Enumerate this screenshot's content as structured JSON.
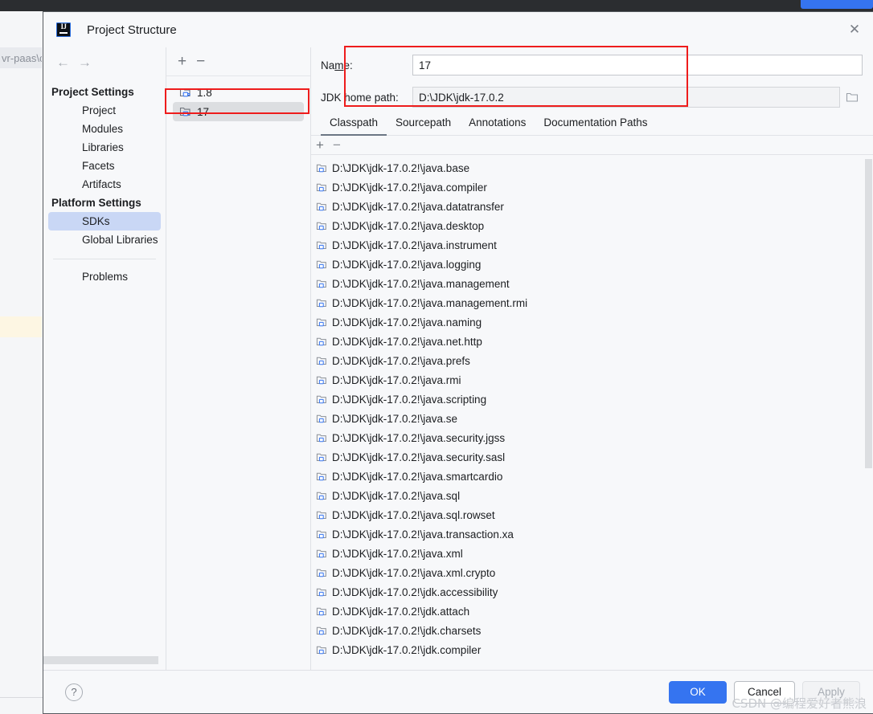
{
  "background": {
    "breadcrumb_text": "vr-paas\\c",
    "accent_blue": "#3574f0",
    "topbar_color": "#2b2d30"
  },
  "dialog": {
    "title": "Project Structure",
    "logo_icon": "intellij-idea-logo-icon",
    "close_icon": "close-icon"
  },
  "nav": {
    "back_icon": "arrow-left-icon",
    "forward_icon": "arrow-right-icon",
    "groups": [
      {
        "header": "Project Settings",
        "items": [
          {
            "label": "Project",
            "selected": false
          },
          {
            "label": "Modules",
            "selected": false
          },
          {
            "label": "Libraries",
            "selected": false
          },
          {
            "label": "Facets",
            "selected": false
          },
          {
            "label": "Artifacts",
            "selected": false
          }
        ]
      },
      {
        "header": "Platform Settings",
        "items": [
          {
            "label": "SDKs",
            "selected": true
          },
          {
            "label": "Global Libraries",
            "selected": false
          }
        ]
      }
    ],
    "extra_items": [
      {
        "label": "Problems",
        "selected": false
      }
    ]
  },
  "sdk_pane": {
    "add_icon": "plus-icon",
    "remove_icon": "minus-icon",
    "items": [
      {
        "label": "1.8",
        "icon": "jdk-icon",
        "selected": false
      },
      {
        "label": "17",
        "icon": "jdk-icon",
        "selected": true
      }
    ]
  },
  "detail": {
    "name_label": "Name:",
    "name_label_pre": "Na",
    "name_label_accel": "m",
    "name_label_post": "e:",
    "name_value": "17",
    "path_label": "JDK home path:",
    "path_value": "D:\\JDK\\jdk-17.0.2",
    "browse_icon": "folder-open-icon",
    "tabs": [
      {
        "label": "Classpath",
        "active": true
      },
      {
        "label": "Sourcepath",
        "active": false
      },
      {
        "label": "Annotations",
        "active": false
      },
      {
        "label": "Documentation Paths",
        "active": false
      }
    ],
    "classpath_toolbar": {
      "add_icon": "plus-icon",
      "remove_icon": "minus-icon"
    },
    "classpath_entries": [
      "D:\\JDK\\jdk-17.0.2!\\java.base",
      "D:\\JDK\\jdk-17.0.2!\\java.compiler",
      "D:\\JDK\\jdk-17.0.2!\\java.datatransfer",
      "D:\\JDK\\jdk-17.0.2!\\java.desktop",
      "D:\\JDK\\jdk-17.0.2!\\java.instrument",
      "D:\\JDK\\jdk-17.0.2!\\java.logging",
      "D:\\JDK\\jdk-17.0.2!\\java.management",
      "D:\\JDK\\jdk-17.0.2!\\java.management.rmi",
      "D:\\JDK\\jdk-17.0.2!\\java.naming",
      "D:\\JDK\\jdk-17.0.2!\\java.net.http",
      "D:\\JDK\\jdk-17.0.2!\\java.prefs",
      "D:\\JDK\\jdk-17.0.2!\\java.rmi",
      "D:\\JDK\\jdk-17.0.2!\\java.scripting",
      "D:\\JDK\\jdk-17.0.2!\\java.se",
      "D:\\JDK\\jdk-17.0.2!\\java.security.jgss",
      "D:\\JDK\\jdk-17.0.2!\\java.security.sasl",
      "D:\\JDK\\jdk-17.0.2!\\java.smartcardio",
      "D:\\JDK\\jdk-17.0.2!\\java.sql",
      "D:\\JDK\\jdk-17.0.2!\\java.sql.rowset",
      "D:\\JDK\\jdk-17.0.2!\\java.transaction.xa",
      "D:\\JDK\\jdk-17.0.2!\\java.xml",
      "D:\\JDK\\jdk-17.0.2!\\java.xml.crypto",
      "D:\\JDK\\jdk-17.0.2!\\jdk.accessibility",
      "D:\\JDK\\jdk-17.0.2!\\jdk.attach",
      "D:\\JDK\\jdk-17.0.2!\\jdk.charsets",
      "D:\\JDK\\jdk-17.0.2!\\jdk.compiler"
    ]
  },
  "footer": {
    "help_label": "?",
    "ok_label": "OK",
    "cancel_label": "Cancel",
    "apply_label": "Apply",
    "primary_color": "#3574f0"
  },
  "watermark": "CSDN @编程爱好者熊浪"
}
